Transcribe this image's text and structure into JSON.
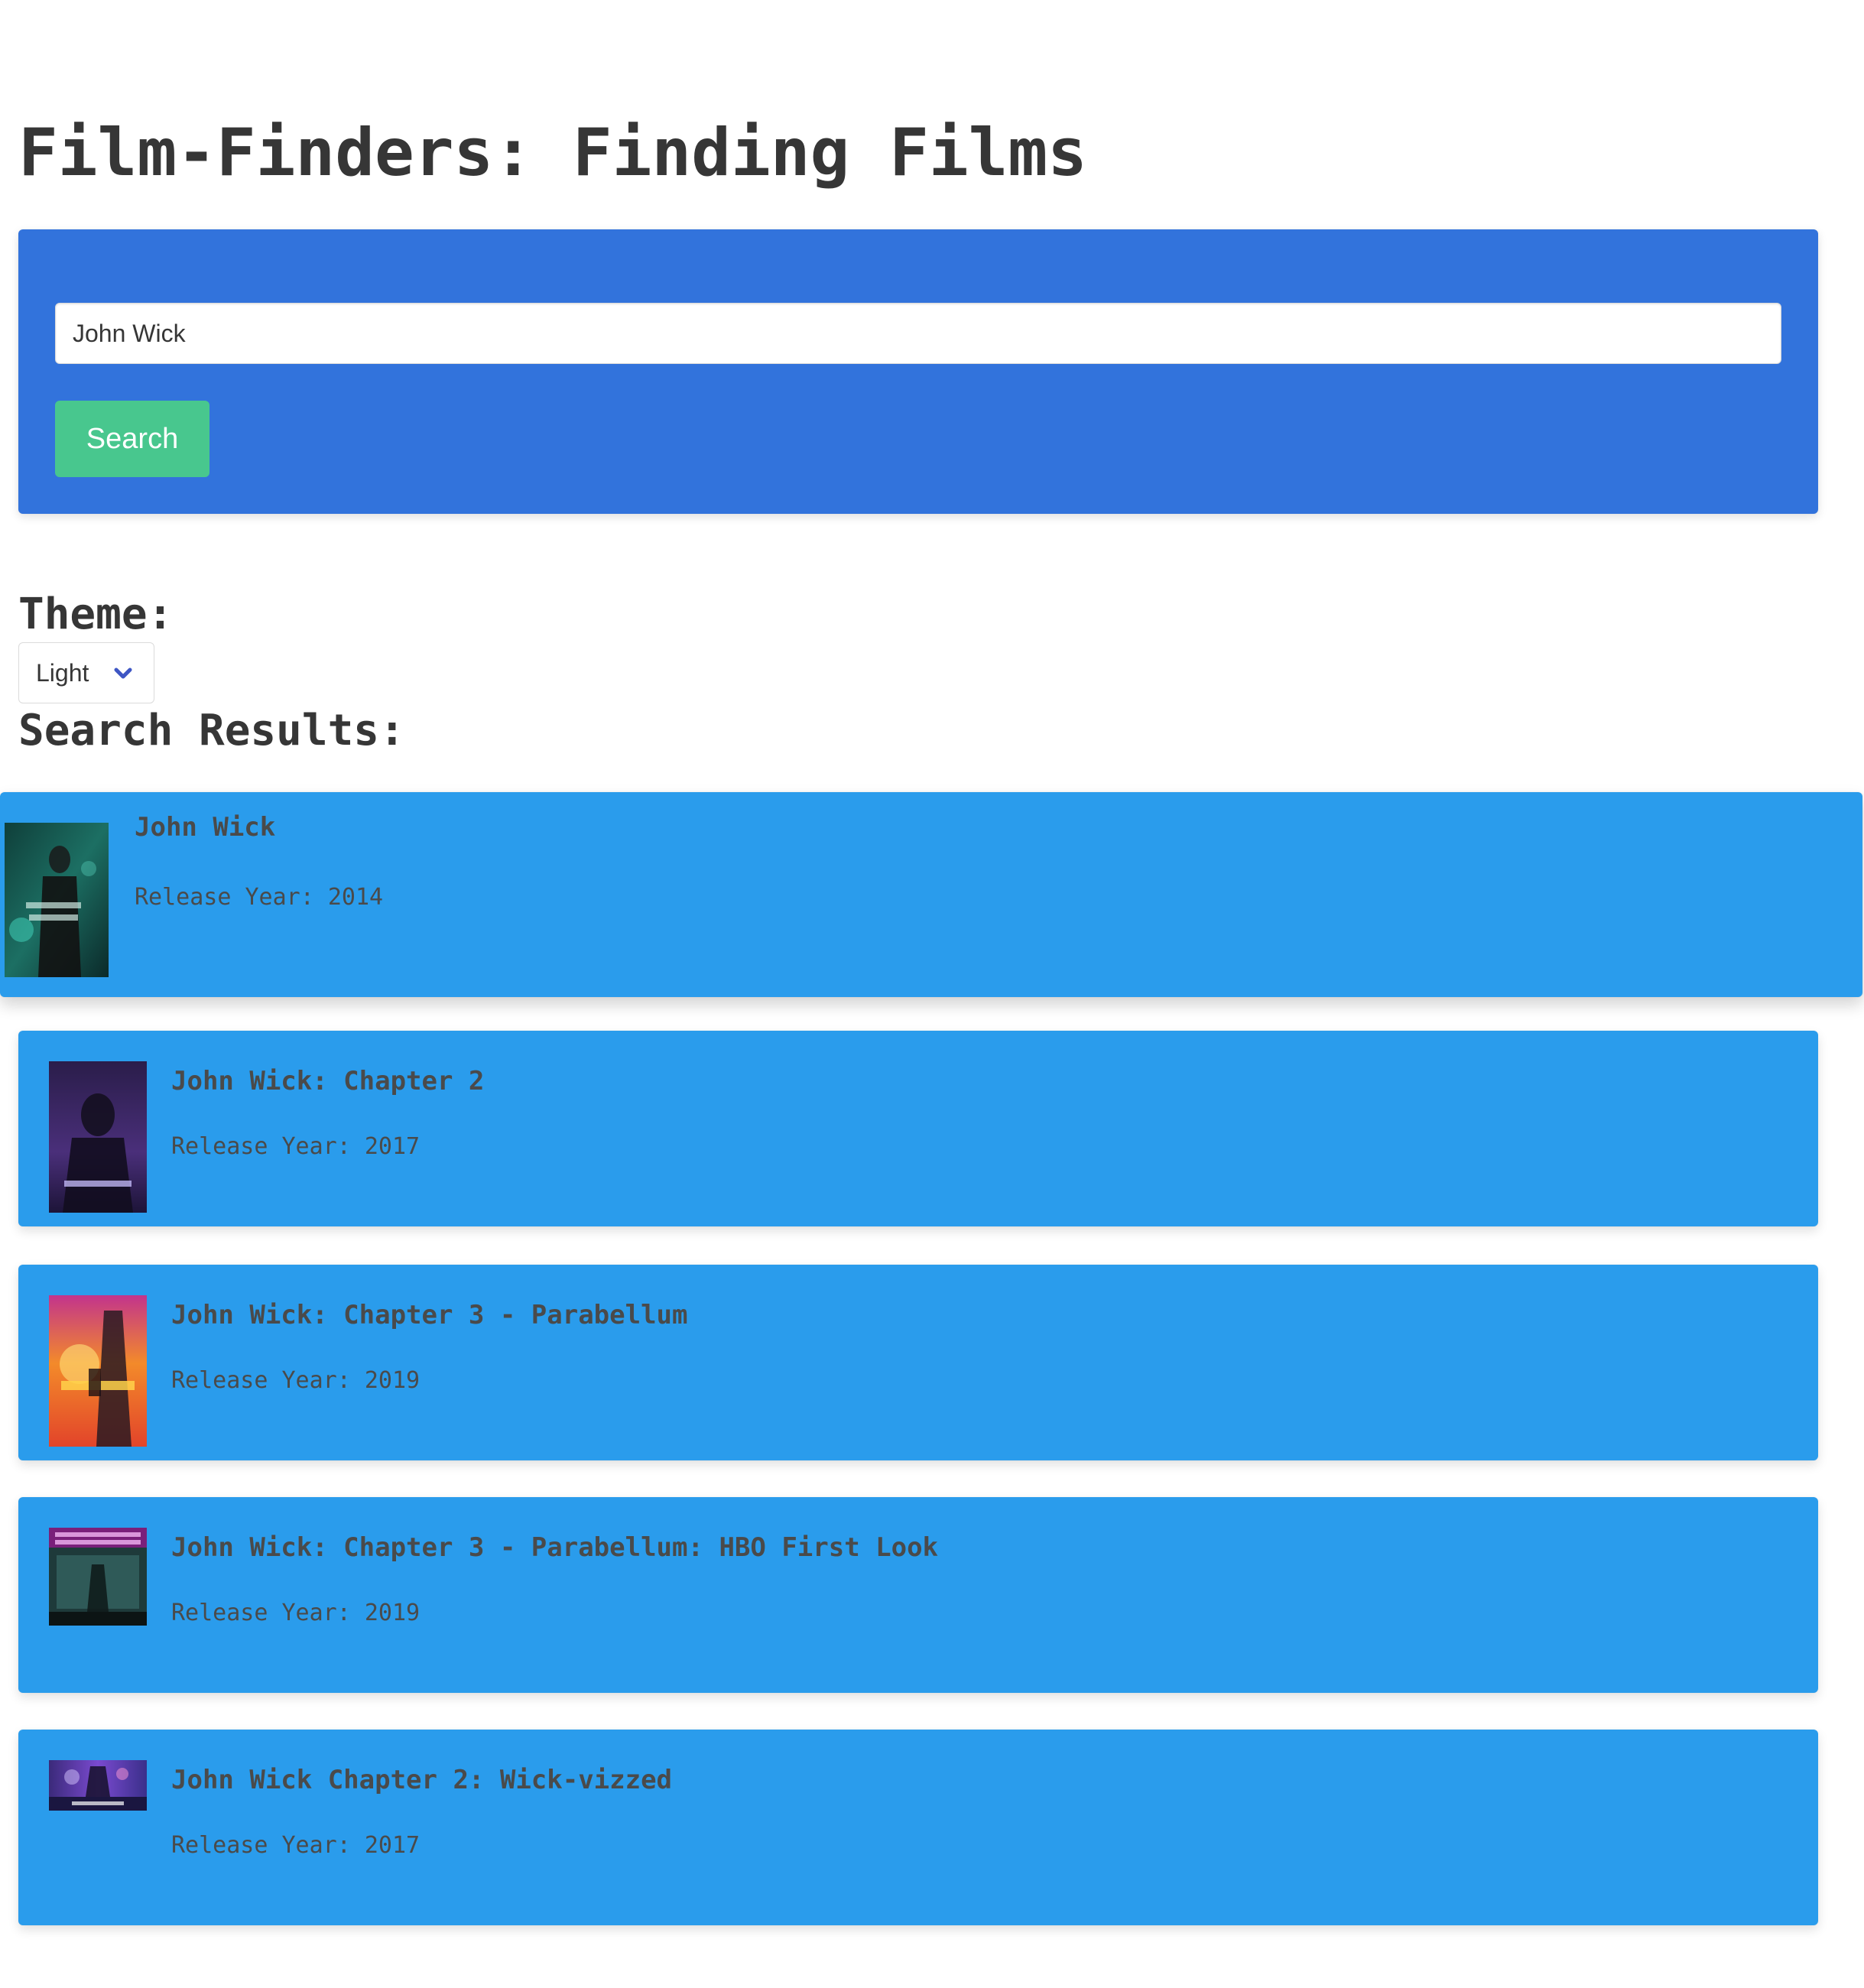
{
  "header": {
    "title": "Film-Finders: Finding Films"
  },
  "search": {
    "value": "John Wick",
    "button_label": "Search"
  },
  "theme": {
    "label": "Theme:",
    "selected": "Light"
  },
  "results": {
    "heading": "Search Results:",
    "year_label": "Release Year:",
    "items": [
      {
        "title": "John Wick",
        "year": "2014",
        "poster_icon": "john-wick-poster"
      },
      {
        "title": "John Wick: Chapter 2",
        "year": "2017",
        "poster_icon": "john-wick-chapter-2-poster"
      },
      {
        "title": "John Wick: Chapter 3 - Parabellum",
        "year": "2019",
        "poster_icon": "john-wick-chapter-3-poster"
      },
      {
        "title": "John Wick: Chapter 3 - Parabellum: HBO First Look",
        "year": "2019",
        "poster_icon": "hbo-first-look-poster"
      },
      {
        "title": "John Wick Chapter 2: Wick-vizzed",
        "year": "2017",
        "poster_icon": "wick-vizzed-poster"
      }
    ]
  },
  "colors": {
    "primary": "#3273dc",
    "success": "#48c78e",
    "card": "#2a9cec",
    "text": "#363636"
  }
}
